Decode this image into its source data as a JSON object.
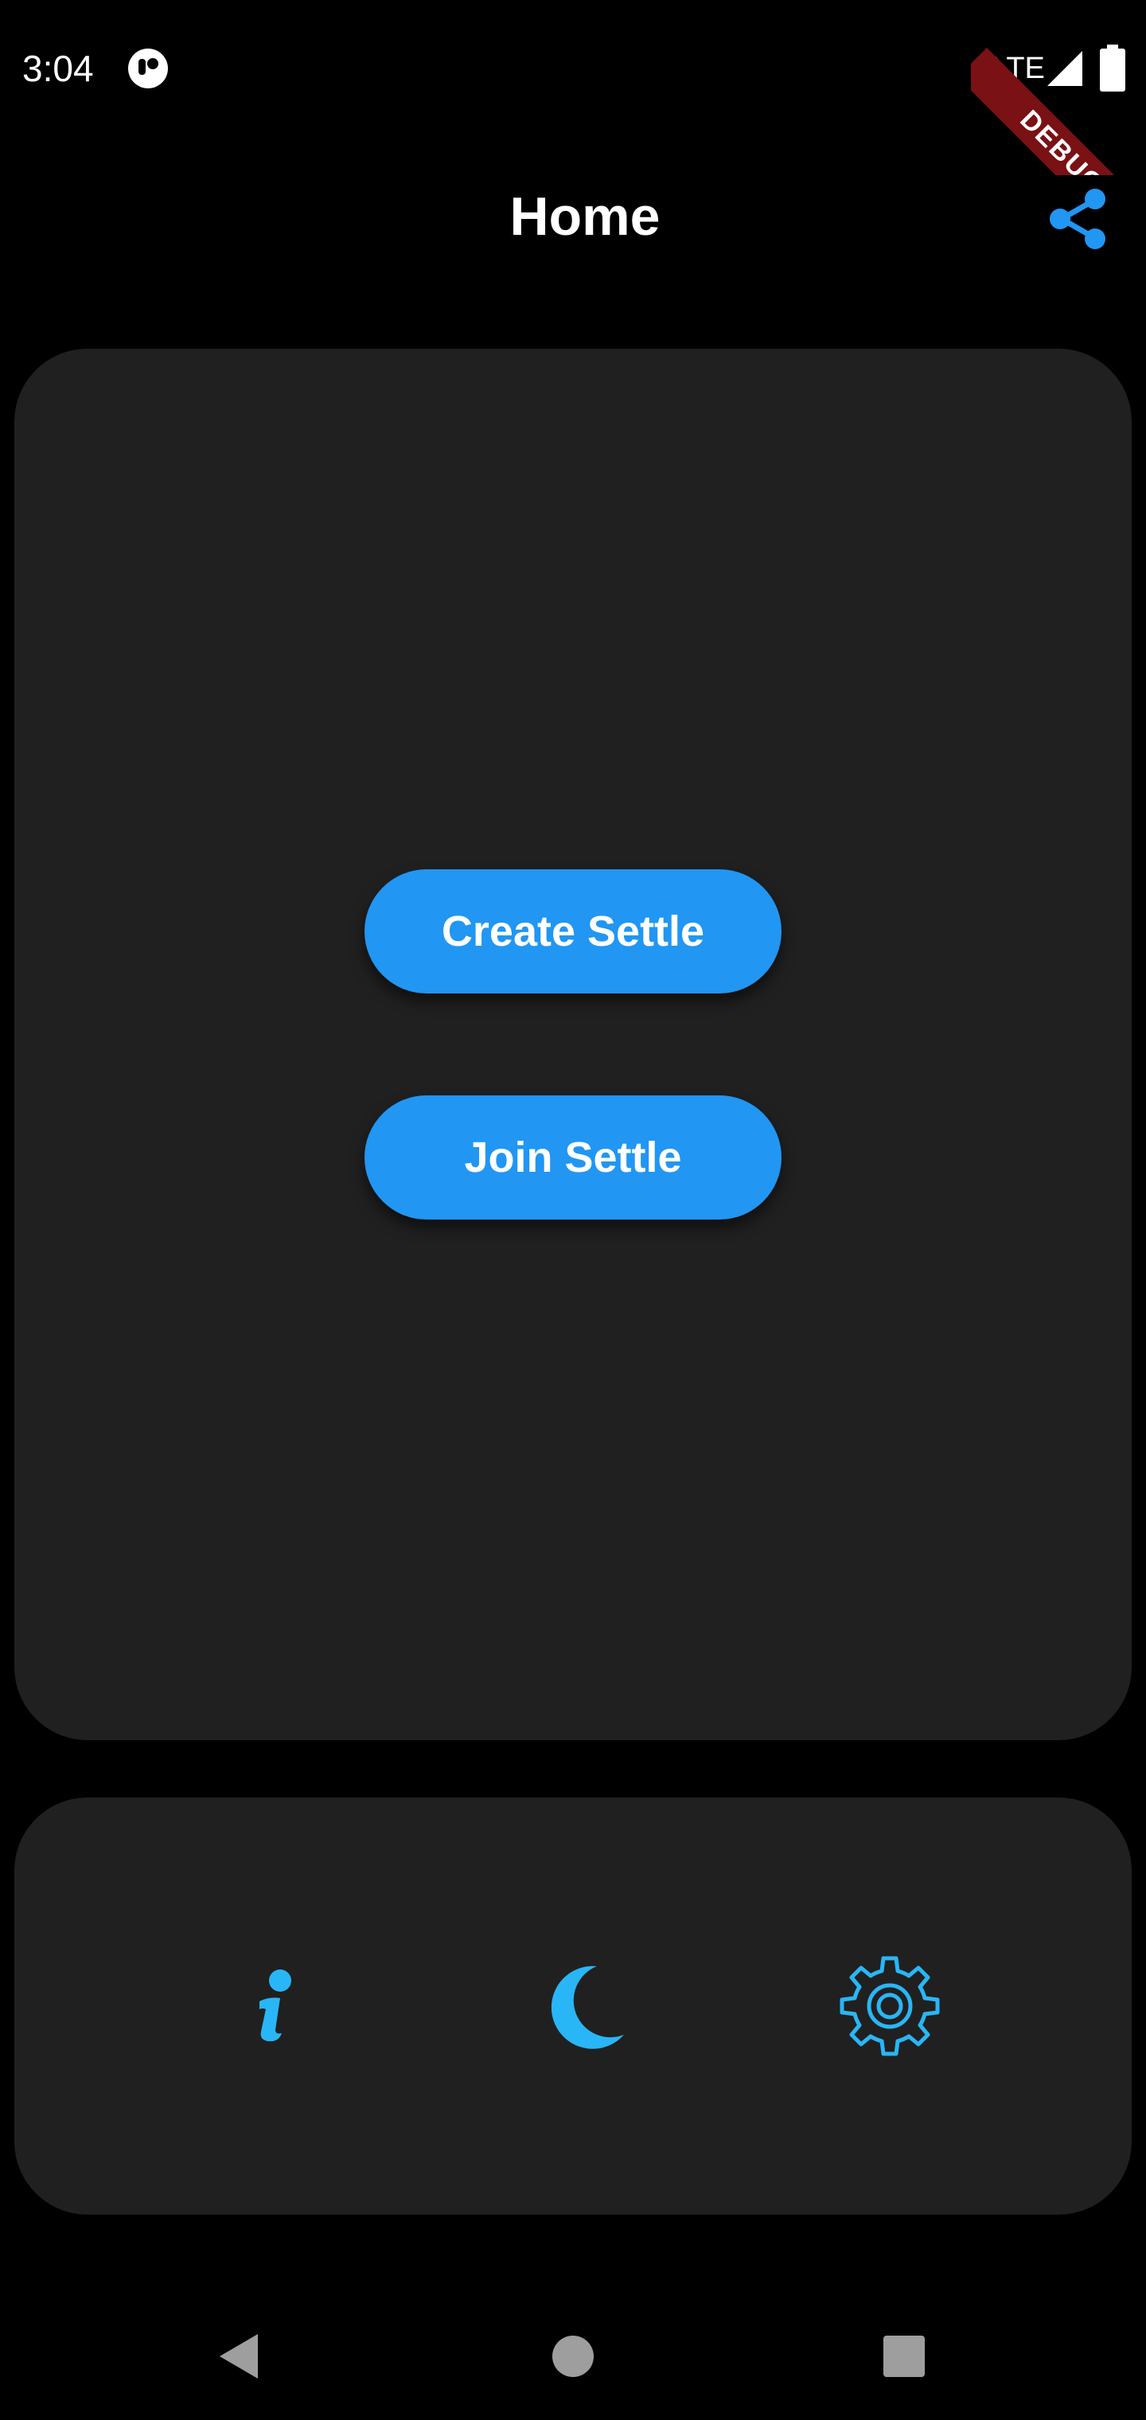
{
  "status_bar": {
    "time": "3:04",
    "network": "LTE",
    "app_icon": "app-notification-icon",
    "signal_icon": "signal-icon",
    "battery_icon": "battery-icon"
  },
  "debug_banner": {
    "label": "DEBUG",
    "color": "#7a1114"
  },
  "app_bar": {
    "title": "Home",
    "share_icon": "share-icon"
  },
  "main_card": {
    "create_label": "Create Settle",
    "join_label": "Join Settle"
  },
  "bottom_bar": {
    "items": [
      {
        "icon": "info-icon"
      },
      {
        "icon": "moon-icon"
      },
      {
        "icon": "settings-icon"
      }
    ]
  },
  "nav_bar": {
    "items": [
      {
        "icon": "back-triangle-icon"
      },
      {
        "icon": "home-circle-icon"
      },
      {
        "icon": "recents-square-icon"
      }
    ]
  },
  "colors": {
    "background": "#000000",
    "card": "#202020",
    "accent": "#2196f3",
    "icon_accent": "#29b6f6",
    "text": "#ffffff",
    "nav_icon": "#9e9e9e"
  }
}
